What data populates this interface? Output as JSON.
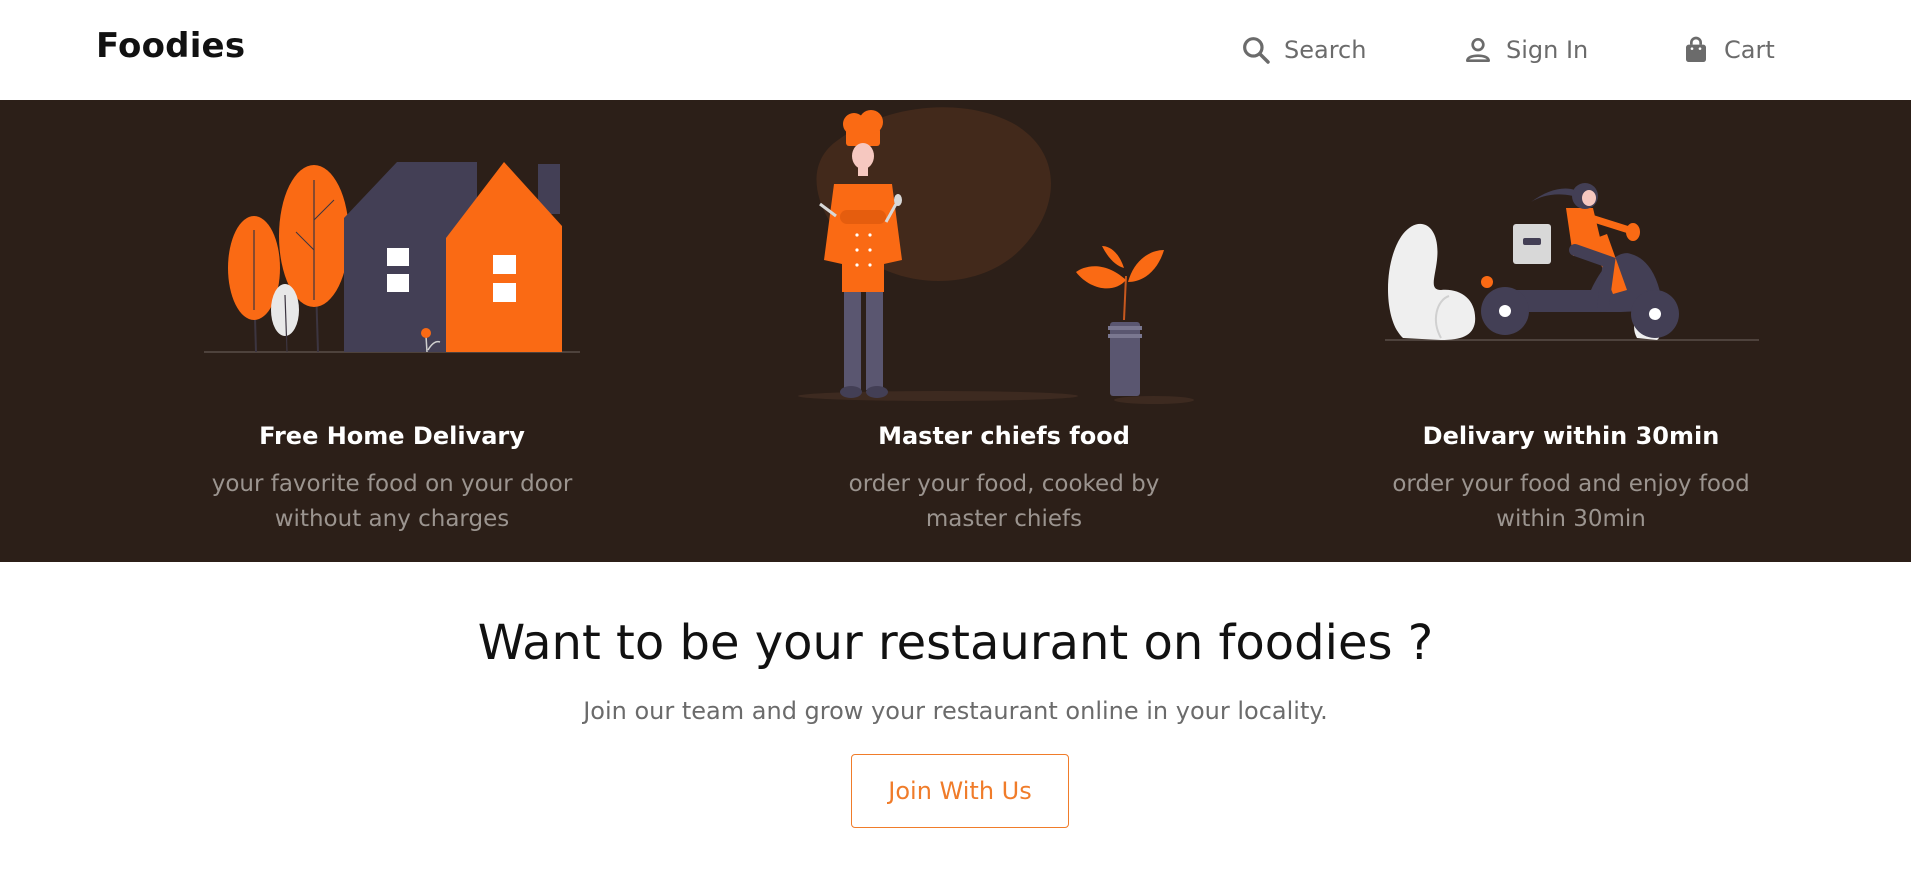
{
  "header": {
    "logo": "Foodies",
    "nav": {
      "search_label": "Search",
      "signin_label": "Sign In",
      "cart_label": "Cart"
    },
    "icons": [
      "search-icon",
      "user-icon",
      "shopping-bag-icon"
    ]
  },
  "features": [
    {
      "title": "Free Home Delivary",
      "description": "your favorite food on your door without any charges",
      "illustration": "house-illustration"
    },
    {
      "title": "Master chiefs food",
      "description": "order your food, cooked by master chiefs",
      "illustration": "chef-illustration"
    },
    {
      "title": "Delivary within 30min",
      "description": "order your food and enjoy food within 30min",
      "illustration": "scooter-delivery-illustration"
    }
  ],
  "cta": {
    "title": "Want to be your restaurant on foodies ?",
    "subtitle": "Join our team and grow your restaurant online in your locality.",
    "button_label": "Join With Us"
  },
  "colors": {
    "accent": "#f07c2a",
    "illustration_orange": "#fa6a14",
    "band_background": "#2c1f18",
    "muted_text": "#6b6b6b",
    "dark_slate": "#433f55"
  }
}
